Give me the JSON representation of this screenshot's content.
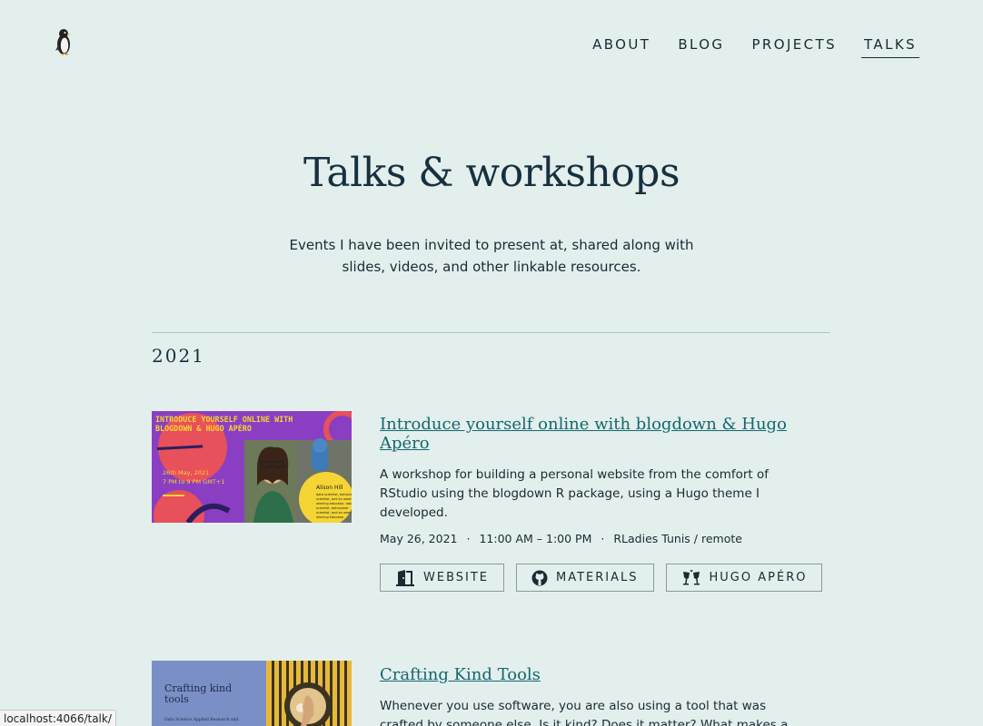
{
  "header": {
    "logo_icon": "penguin-icon",
    "nav": [
      {
        "label": "ABOUT",
        "active": false
      },
      {
        "label": "BLOG",
        "active": false
      },
      {
        "label": "PROJECTS",
        "active": false
      },
      {
        "label": "TALKS",
        "active": true
      }
    ]
  },
  "hero": {
    "title": "Talks & workshops",
    "subtitle": "Events I have been invited to present at, shared along with slides, videos, and other linkable resources."
  },
  "sections": [
    {
      "year": "2021",
      "talks": [
        {
          "title": "Introduce yourself online with blogdown & Hugo Apéro",
          "description": "A workshop for building a personal website from the comfort of RStudio using the blogdown R package, using a Hugo theme I developed.",
          "date": "May 26, 2021",
          "time": "11:00 AM – 1:00 PM",
          "location": "RLadies Tunis / remote",
          "thumbnail": {
            "headline": "INTRODUCE YOURSELF ONLINE WITH BLOGDOWN & HUGO APÉRO",
            "date_line1": "26th May, 2021",
            "date_line2": "7 PM to 9 PM GMT+1",
            "name": "Alison Hill",
            "bio": "data scientist, behavioral scientist, and an award-winning educator, data scientist, behavioral scientist, and an award-winning educator"
          },
          "buttons": [
            {
              "label": "WEBSITE",
              "icon": "door-open-icon"
            },
            {
              "label": "MATERIALS",
              "icon": "github-icon"
            },
            {
              "label": "HUGO APÉRO",
              "icon": "glasses-cheers-icon"
            }
          ]
        },
        {
          "title": "Crafting Kind Tools",
          "description": "Whenever you use software, you are also using a tool that was crafted by someone else. Is it kind? Does it matter? What makes a",
          "thumbnail": {
            "headline": "Crafting kind tools",
            "caption": "Data Science Applied Research and"
          }
        }
      ]
    }
  ],
  "status_bar": {
    "url": "localhost:4066/talk/"
  },
  "colors": {
    "background": "#e3efed",
    "link": "#14676e",
    "text": "#1b2a33",
    "divider": "#a8c7c2"
  }
}
